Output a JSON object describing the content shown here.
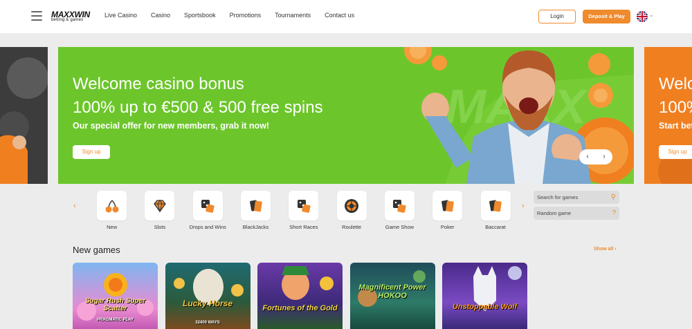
{
  "header": {
    "logo_main": "MAXXWIN",
    "logo_sub": "betting & games",
    "nav": [
      "Live Casino",
      "Casino",
      "Sportsbook",
      "Promotions",
      "Tournaments",
      "Contact us"
    ],
    "login_label": "Login",
    "deposit_label": "Deposit & Play",
    "language": "uk-flag-icon"
  },
  "banner": {
    "title_line1": "Welcome casino bonus",
    "title_line2": "100% up to €500 & 500 free spins",
    "subtitle": "Our special offer for new members, grab it now!",
    "cta_label": "Sign up",
    "prev": "‹",
    "next": "›"
  },
  "right_slide": {
    "title_line1": "Welc",
    "title_line2": "100%",
    "subtitle": "Start bet",
    "cta_label": "Sign up"
  },
  "categories": [
    {
      "label": "New",
      "icon": "cherries-icon"
    },
    {
      "label": "Slots",
      "icon": "diamond-icon"
    },
    {
      "label": "Drops and Wins",
      "icon": "dice-icon"
    },
    {
      "label": "BlackJacks",
      "icon": "cards-icon"
    },
    {
      "label": "Short Races",
      "icon": "dice-icon"
    },
    {
      "label": "Roulette",
      "icon": "roulette-icon"
    },
    {
      "label": "Game Show",
      "icon": "dice-icon"
    },
    {
      "label": "Poker",
      "icon": "cards-icon"
    },
    {
      "label": "Baccarat",
      "icon": "cards-icon"
    }
  ],
  "category_prev": "‹",
  "category_next": "›",
  "search_placeholder": "Search for games",
  "random_label": "Random game",
  "new_games": {
    "title": "New games",
    "show_all": "Show all  ›",
    "games": [
      {
        "name": "Sugar Rush Super Scatter",
        "provider": "PRAGMATIC PLAY"
      },
      {
        "name": "Lucky Horse",
        "provider": "32400 WAYS"
      },
      {
        "name": "Fortunes of the Gold",
        "provider": ""
      },
      {
        "name": "Magnificent Power HOKOO",
        "provider": ""
      },
      {
        "name": "Unstoppable Wolf",
        "provider": ""
      }
    ]
  },
  "colors": {
    "accent": "#ef8a2d",
    "banner_bg": "#6cc62b",
    "page_bg": "#ececec"
  }
}
